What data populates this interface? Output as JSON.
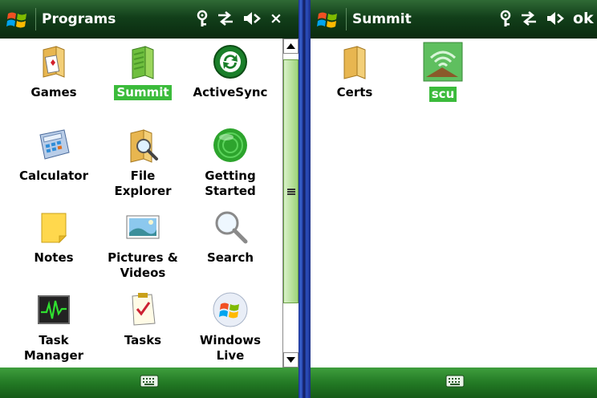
{
  "left": {
    "title": "Programs",
    "close_label": "×",
    "items": [
      {
        "label": "Games",
        "icon": "games-folder-icon",
        "selected": false
      },
      {
        "label": "Summit",
        "icon": "summit-folder-icon",
        "selected": true
      },
      {
        "label": "ActiveSync",
        "icon": "activesync-icon",
        "selected": false
      },
      {
        "label": "Calculator",
        "icon": "calculator-icon",
        "selected": false
      },
      {
        "label": "File Explorer",
        "icon": "file-explorer-icon",
        "selected": false
      },
      {
        "label": "Getting\nStarted",
        "icon": "getting-started-icon",
        "selected": false
      },
      {
        "label": "Notes",
        "icon": "notes-icon",
        "selected": false
      },
      {
        "label": "Pictures &\nVideos",
        "icon": "pictures-videos-icon",
        "selected": false
      },
      {
        "label": "Search",
        "icon": "search-icon",
        "selected": false
      },
      {
        "label": "Task\nManager",
        "icon": "task-manager-icon",
        "selected": false
      },
      {
        "label": "Tasks",
        "icon": "tasks-icon",
        "selected": false
      },
      {
        "label": "Windows\nLive",
        "icon": "windows-live-icon",
        "selected": false
      }
    ]
  },
  "right": {
    "title": "Summit",
    "ok_label": "ok",
    "items": [
      {
        "label": "Certs",
        "icon": "certs-folder-icon",
        "selected": false
      },
      {
        "label": "scu",
        "icon": "scu-app-icon",
        "selected": true
      }
    ]
  },
  "colors": {
    "title_bar": "#123f1a",
    "bottom_bar": "#237a25",
    "selection": "#3bbb3b",
    "divider": "#2b4fc0"
  }
}
